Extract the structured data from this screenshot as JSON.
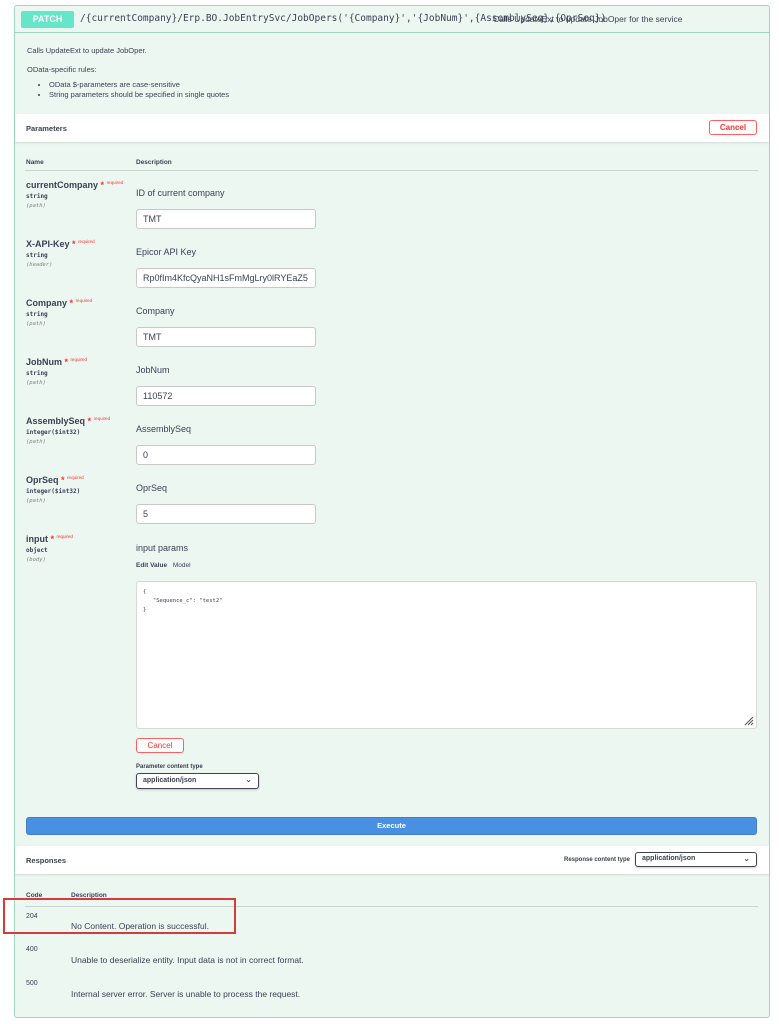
{
  "endpoint": {
    "method": "PATCH",
    "path": "/{currentCompany}/Erp.BO.JobEntrySvc/JobOpers('{Company}','{JobNum}',{AssemblySeq},{OprSeq})",
    "summary": "Calls UpdateExt to update JobOper for the service",
    "description": "Calls UpdateExt to update JobOper.",
    "rules_title": "OData-specific rules:",
    "rules": [
      "OData $-parameters are case-sensitive",
      "String parameters should be specified in single quotes"
    ]
  },
  "parameters": {
    "title": "Parameters",
    "cancel_label": "Cancel",
    "col_name": "Name",
    "col_description": "Description",
    "required_mark": "*",
    "required_text": "required",
    "items": [
      {
        "name": "currentCompany",
        "type": "string",
        "in": "(path)",
        "description": "ID of current company",
        "value": "TMT"
      },
      {
        "name": "X-API-Key",
        "type": "string",
        "in": "(header)",
        "description": "Epicor API Key",
        "value": "Rp0fIm4KfcQyaNH1sFmMgLry0lRYEaZ5"
      },
      {
        "name": "Company",
        "type": "string",
        "in": "(path)",
        "description": "Company",
        "value": "TMT"
      },
      {
        "name": "JobNum",
        "type": "string",
        "in": "(path)",
        "description": "JobNum",
        "value": "110572"
      },
      {
        "name": "AssemblySeq",
        "type": "integer($int32)",
        "in": "(path)",
        "description": "AssemblySeq",
        "value": "0"
      },
      {
        "name": "OprSeq",
        "type": "integer($int32)",
        "in": "(path)",
        "description": "OprSeq",
        "value": "5"
      },
      {
        "name": "input",
        "type": "object",
        "in": "(body)",
        "description": "input params"
      }
    ],
    "body_tabs": {
      "edit_value": "Edit Value",
      "model": "Model"
    },
    "body_value": "{\n   \"Sequence_c\": \"test2\"\n}",
    "body_cancel_label": "Cancel",
    "content_type_label": "Parameter content type",
    "content_type_value": "application/json"
  },
  "execute_label": "Execute",
  "responses": {
    "title": "Responses",
    "content_type_label": "Response content type",
    "content_type_value": "application/json",
    "col_code": "Code",
    "col_description": "Description",
    "items": [
      {
        "code": "204",
        "description": "No Content. Operation is successful."
      },
      {
        "code": "400",
        "description": "Unable to deserialize entity. Input data is not in correct format."
      },
      {
        "code": "500",
        "description": "Internal server error. Server is unable to process the request."
      }
    ]
  },
  "colors": {
    "method_badge": "#50e3c2",
    "panel_bg": "#edf7f2",
    "execute": "#4990e2",
    "cancel": "#ff3030",
    "highlight": "#d63b3b"
  }
}
